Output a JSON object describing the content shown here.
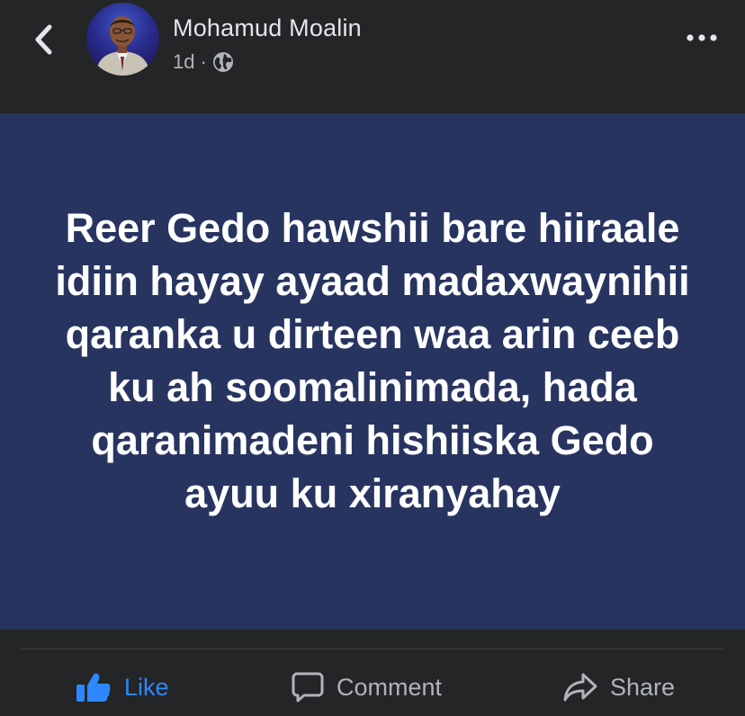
{
  "header": {
    "back_icon": "chevron-left-icon",
    "author_name": "Mohamud Moalin",
    "timestamp": "1d",
    "separator": "·",
    "audience_icon": "globe-icon",
    "more_icon": "more-horizontal-icon"
  },
  "post": {
    "text": "Reer Gedo hawshii bare hiiraale idiin hayay ayaad madaxwaynihii qaranka u dirteen waa arin ceeb ku ah soomalinimada, hada qaranimadeni hishiiska Gedo ayuu ku xiranyahay",
    "background_color": "#283460"
  },
  "actions": {
    "like_label": "Like",
    "comment_label": "Comment",
    "share_label": "Share",
    "like_color": "#2d88ff"
  }
}
